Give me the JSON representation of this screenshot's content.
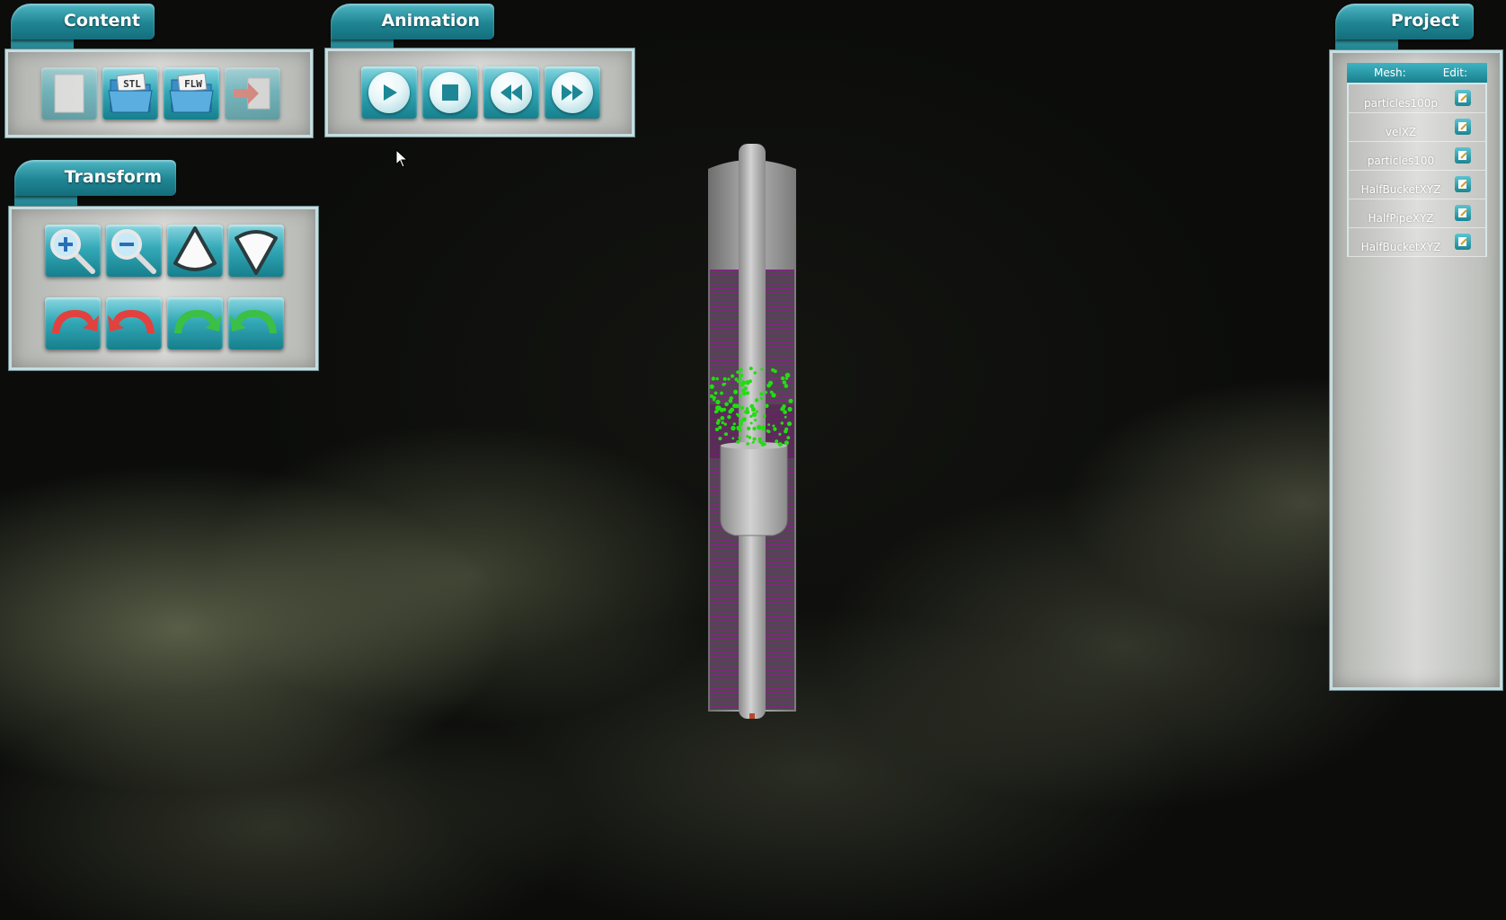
{
  "panels": {
    "content": {
      "title": "Content",
      "buttons": [
        {
          "name": "new-document",
          "label": "",
          "enabled": false
        },
        {
          "name": "open-stl",
          "label": "STL",
          "enabled": true
        },
        {
          "name": "open-flw",
          "label": "FLW",
          "enabled": true
        },
        {
          "name": "export",
          "label": "",
          "enabled": false
        }
      ]
    },
    "animation": {
      "title": "Animation",
      "buttons": [
        "play",
        "stop",
        "rewind",
        "fast-forward"
      ]
    },
    "transform": {
      "title": "Transform",
      "buttons": [
        "zoom-in",
        "zoom-out",
        "move-up",
        "move-down",
        "rotate-left-red",
        "rotate-right-red",
        "rotate-left-green",
        "rotate-right-green"
      ]
    },
    "project": {
      "title": "Project",
      "mesh_header": "Mesh:",
      "edit_header": "Edit:",
      "items": [
        {
          "name": "particles100p"
        },
        {
          "name": "velXZ"
        },
        {
          "name": "particles100"
        },
        {
          "name": "HalfBucketXYZ"
        },
        {
          "name": "HalfPipeXYZ"
        },
        {
          "name": "HalfBucketXYZ"
        }
      ]
    }
  },
  "colors": {
    "accent": "#1f8593",
    "particles": "#22dd11",
    "mesh_gray": "#9a9a9a",
    "stripe_purple": "#7a2a7a"
  }
}
